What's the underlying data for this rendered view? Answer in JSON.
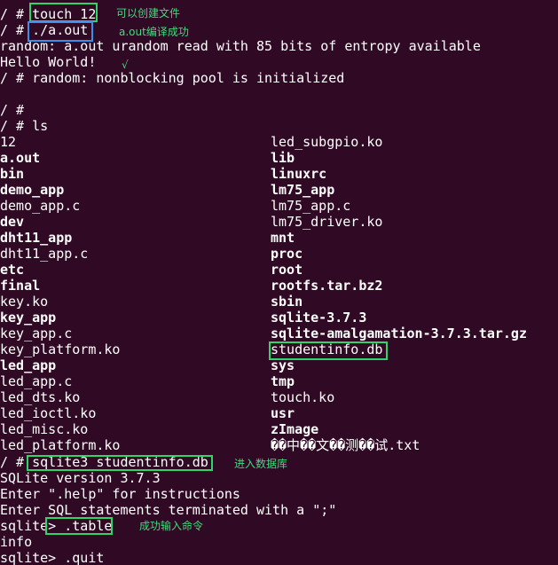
{
  "terminal": {
    "lines_top": [
      "/ # touch 12",
      "/ # ./a.out",
      "random: a.out urandom read with 85 bits of entropy available",
      "Hello World!",
      "/ # random: nonblocking pool is initialized",
      "",
      "/ #",
      "/ # ls"
    ],
    "ls_left": [
      {
        "name": "12",
        "bold": false
      },
      {
        "name": "a.out",
        "bold": true
      },
      {
        "name": "bin",
        "bold": true
      },
      {
        "name": "demo_app",
        "bold": true
      },
      {
        "name": "demo_app.c",
        "bold": false
      },
      {
        "name": "dev",
        "bold": true
      },
      {
        "name": "dht11_app",
        "bold": true
      },
      {
        "name": "dht11_app.c",
        "bold": false
      },
      {
        "name": "etc",
        "bold": true
      },
      {
        "name": "final",
        "bold": true
      },
      {
        "name": "key.ko",
        "bold": false
      },
      {
        "name": "key_app",
        "bold": true
      },
      {
        "name": "key_app.c",
        "bold": false
      },
      {
        "name": "key_platform.ko",
        "bold": false
      },
      {
        "name": "led_app",
        "bold": true
      },
      {
        "name": "led_app.c",
        "bold": false
      },
      {
        "name": "led_dts.ko",
        "bold": false
      },
      {
        "name": "led_ioctl.ko",
        "bold": false
      },
      {
        "name": "led_misc.ko",
        "bold": false
      },
      {
        "name": "led_platform.ko",
        "bold": false
      }
    ],
    "ls_right": [
      {
        "name": "led_subgpio.ko",
        "bold": false
      },
      {
        "name": "lib",
        "bold": true
      },
      {
        "name": "linuxrc",
        "bold": true
      },
      {
        "name": "lm75_app",
        "bold": true
      },
      {
        "name": "lm75_app.c",
        "bold": false
      },
      {
        "name": "lm75_driver.ko",
        "bold": false
      },
      {
        "name": "mnt",
        "bold": true
      },
      {
        "name": "proc",
        "bold": true
      },
      {
        "name": "root",
        "bold": true
      },
      {
        "name": "rootfs.tar.bz2",
        "bold": true
      },
      {
        "name": "sbin",
        "bold": true
      },
      {
        "name": "sqlite-3.7.3",
        "bold": true
      },
      {
        "name": "sqlite-amalgamation-3.7.3.tar.gz",
        "bold": true
      },
      {
        "name": "studentinfo.db",
        "bold": false
      },
      {
        "name": "sys",
        "bold": true
      },
      {
        "name": "tmp",
        "bold": true
      },
      {
        "name": "touch.ko",
        "bold": false
      },
      {
        "name": "usr",
        "bold": true
      },
      {
        "name": "zImage",
        "bold": true
      },
      {
        "name": "��中��文��测��试.txt",
        "bold": false
      }
    ],
    "lines_bottom": [
      "/ # sqlite3 studentinfo.db",
      "SQLite version 3.7.3",
      "Enter \".help\" for instructions",
      "Enter SQL statements terminated with a \";\"",
      "sqlite> .table",
      "info",
      "sqlite> .quit"
    ]
  },
  "annotations": {
    "touch": "可以创建文件",
    "aout": "a.out编译成功",
    "check": "√",
    "sqlite": "进入数据库",
    "table": "成功输入命令"
  },
  "colors": {
    "background": "#300a24",
    "text": "#ffffff",
    "highlight_green": "#2ed66a",
    "highlight_blue": "#3a8fe6",
    "annotation_text": "#3ddc7a"
  }
}
